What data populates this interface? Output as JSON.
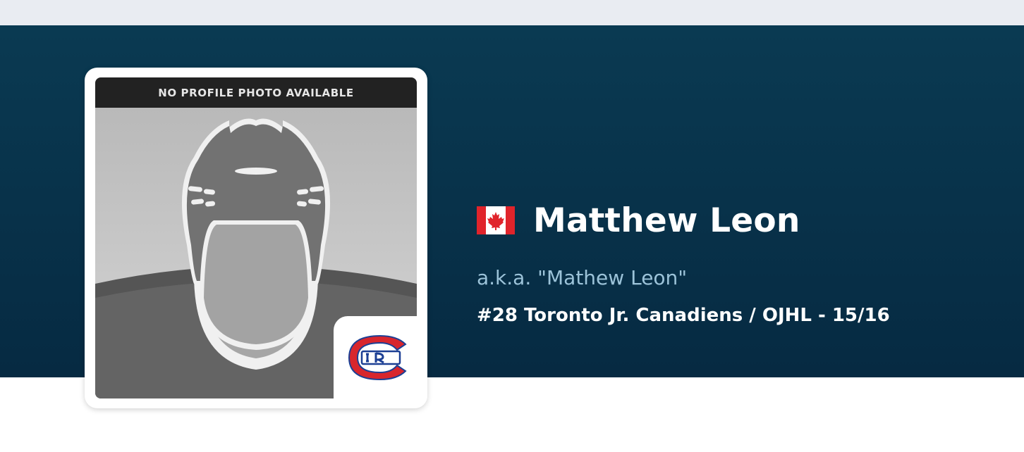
{
  "profile": {
    "photo_banner": "NO PROFILE PHOTO AVAILABLE",
    "name": "Matthew Leon",
    "aka": "a.k.a. \"Mathew Leon\"",
    "team_line": "#28 Toronto Jr. Canadiens / OJHL - 15/16",
    "nationality_icon": "canada-flag-icon",
    "team_logo_icon": "toronto-jr-canadiens-logo-icon"
  },
  "colors": {
    "hero_background": "#0a3a52",
    "aka_text": "#9cc3d9",
    "top_strip": "#e9ecf2",
    "flag_red": "#e0242b",
    "logo_red": "#d8262d",
    "logo_blue": "#1c3f94"
  }
}
